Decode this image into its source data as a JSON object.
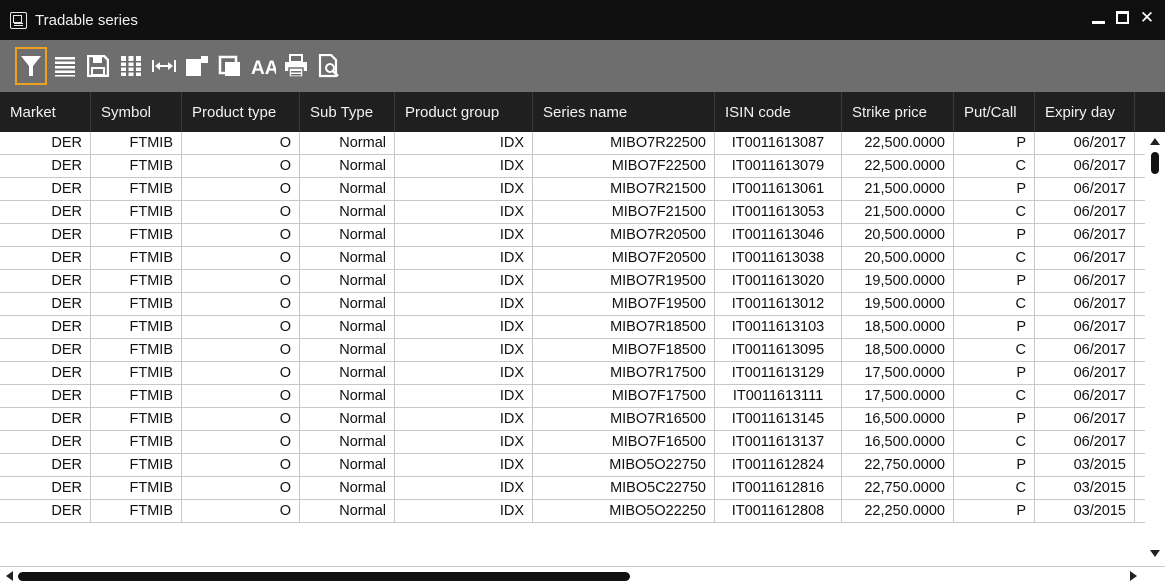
{
  "window": {
    "title": "Tradable series",
    "icon": "window-app-icon",
    "controls": [
      "minimize-icon",
      "maximize-icon",
      "close-icon"
    ],
    "close_glyph": "✕"
  },
  "toolbar": {
    "buttons": [
      {
        "name": "filter-icon",
        "active": true
      },
      {
        "name": "list-icon",
        "active": false
      },
      {
        "name": "save-icon",
        "active": false
      },
      {
        "name": "columns-icon",
        "active": false
      },
      {
        "name": "fit-width-icon",
        "active": false
      },
      {
        "name": "export-icon",
        "active": false
      },
      {
        "name": "copy-icon",
        "active": false
      },
      {
        "name": "font-size-icon",
        "active": false
      },
      {
        "name": "print-icon",
        "active": false
      },
      {
        "name": "print-preview-icon",
        "active": false
      }
    ],
    "font_label": "AA",
    "accent": "#f0a020"
  },
  "grid": {
    "columns": [
      "Market",
      "Symbol",
      "Product type",
      "Sub Type",
      "Product group",
      "Series name",
      "ISIN code",
      "Strike price",
      "Put/Call",
      "Expiry day"
    ],
    "rows": [
      [
        "DER",
        "FTMIB",
        "O",
        "Normal",
        "IDX",
        "MIBO7R22500",
        "IT0011613087",
        "22,500.0000",
        "P",
        "06/2017"
      ],
      [
        "DER",
        "FTMIB",
        "O",
        "Normal",
        "IDX",
        "MIBO7F22500",
        "IT0011613079",
        "22,500.0000",
        "C",
        "06/2017"
      ],
      [
        "DER",
        "FTMIB",
        "O",
        "Normal",
        "IDX",
        "MIBO7R21500",
        "IT0011613061",
        "21,500.0000",
        "P",
        "06/2017"
      ],
      [
        "DER",
        "FTMIB",
        "O",
        "Normal",
        "IDX",
        "MIBO7F21500",
        "IT0011613053",
        "21,500.0000",
        "C",
        "06/2017"
      ],
      [
        "DER",
        "FTMIB",
        "O",
        "Normal",
        "IDX",
        "MIBO7R20500",
        "IT0011613046",
        "20,500.0000",
        "P",
        "06/2017"
      ],
      [
        "DER",
        "FTMIB",
        "O",
        "Normal",
        "IDX",
        "MIBO7F20500",
        "IT0011613038",
        "20,500.0000",
        "C",
        "06/2017"
      ],
      [
        "DER",
        "FTMIB",
        "O",
        "Normal",
        "IDX",
        "MIBO7R19500",
        "IT0011613020",
        "19,500.0000",
        "P",
        "06/2017"
      ],
      [
        "DER",
        "FTMIB",
        "O",
        "Normal",
        "IDX",
        "MIBO7F19500",
        "IT0011613012",
        "19,500.0000",
        "C",
        "06/2017"
      ],
      [
        "DER",
        "FTMIB",
        "O",
        "Normal",
        "IDX",
        "MIBO7R18500",
        "IT0011613103",
        "18,500.0000",
        "P",
        "06/2017"
      ],
      [
        "DER",
        "FTMIB",
        "O",
        "Normal",
        "IDX",
        "MIBO7F18500",
        "IT0011613095",
        "18,500.0000",
        "C",
        "06/2017"
      ],
      [
        "DER",
        "FTMIB",
        "O",
        "Normal",
        "IDX",
        "MIBO7R17500",
        "IT0011613129",
        "17,500.0000",
        "P",
        "06/2017"
      ],
      [
        "DER",
        "FTMIB",
        "O",
        "Normal",
        "IDX",
        "MIBO7F17500",
        "IT0011613111",
        "17,500.0000",
        "C",
        "06/2017"
      ],
      [
        "DER",
        "FTMIB",
        "O",
        "Normal",
        "IDX",
        "MIBO7R16500",
        "IT0011613145",
        "16,500.0000",
        "P",
        "06/2017"
      ],
      [
        "DER",
        "FTMIB",
        "O",
        "Normal",
        "IDX",
        "MIBO7F16500",
        "IT0011613137",
        "16,500.0000",
        "C",
        "06/2017"
      ],
      [
        "DER",
        "FTMIB",
        "O",
        "Normal",
        "IDX",
        "MIBO5O22750",
        "IT0011612824",
        "22,750.0000",
        "P",
        "03/2015"
      ],
      [
        "DER",
        "FTMIB",
        "O",
        "Normal",
        "IDX",
        "MIBO5C22750",
        "IT0011612816",
        "22,750.0000",
        "C",
        "03/2015"
      ],
      [
        "DER",
        "FTMIB",
        "O",
        "Normal",
        "IDX",
        "MIBO5O22250",
        "IT0011612808",
        "22,250.0000",
        "P",
        "03/2015"
      ]
    ]
  },
  "colors": {
    "title_bar": "#0f0f0f",
    "toolbar": "#6e6e6e",
    "header": "#1f1f1f",
    "grid_line": "#c8c8c8",
    "cell_bg": "#ffffff"
  }
}
